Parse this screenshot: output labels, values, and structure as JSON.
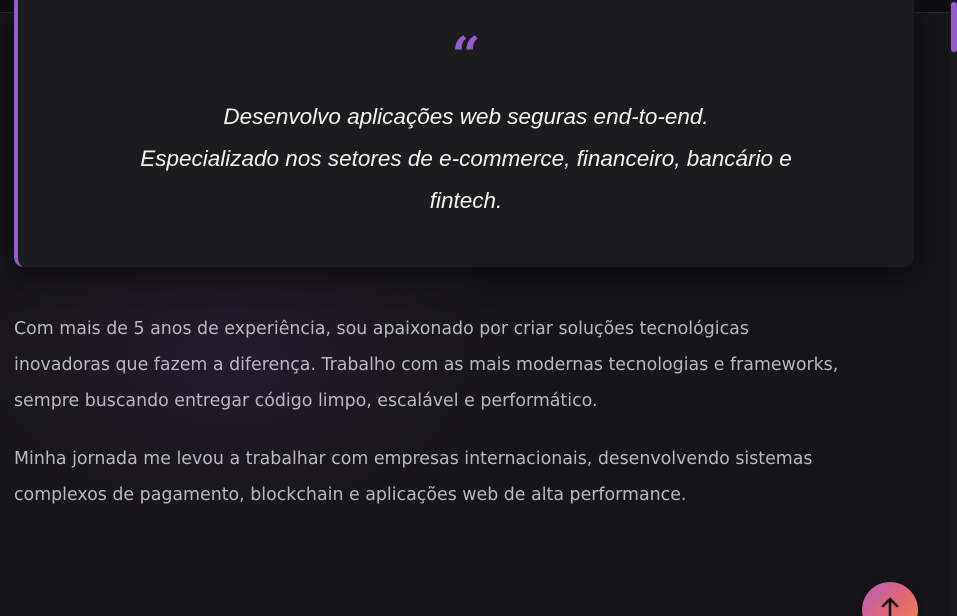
{
  "quote": {
    "mark": "“",
    "lines": [
      "Desenvolvo aplicações web seguras end-to-end.",
      "Especializado nos setores de e-commerce, financeiro, bancário e",
      "fintech."
    ]
  },
  "about": {
    "paragraph_1_lines": [
      "Com mais de 5 anos de experiência, sou apaixonado por criar soluções tecnológicas",
      "inovadoras que fazem a diferença. Trabalho com as mais modernas tecnologias e frameworks,",
      "sempre buscando entregar código limpo, escalável e performático."
    ],
    "paragraph_2_lines": [
      "Minha jornada me levou a trabalhar com empresas internacionais, desenvolvendo sistemas",
      "complexos de pagamento, blockchain e aplicações web de alta performance."
    ]
  },
  "scroll_to_top": {
    "icon": "arrow-up-icon"
  },
  "colors": {
    "accent": "#9b59d0",
    "gradient_start": "#b35ac2",
    "gradient_end": "#ee8a4e",
    "background": "#161519",
    "card": "#1c1c1f"
  }
}
